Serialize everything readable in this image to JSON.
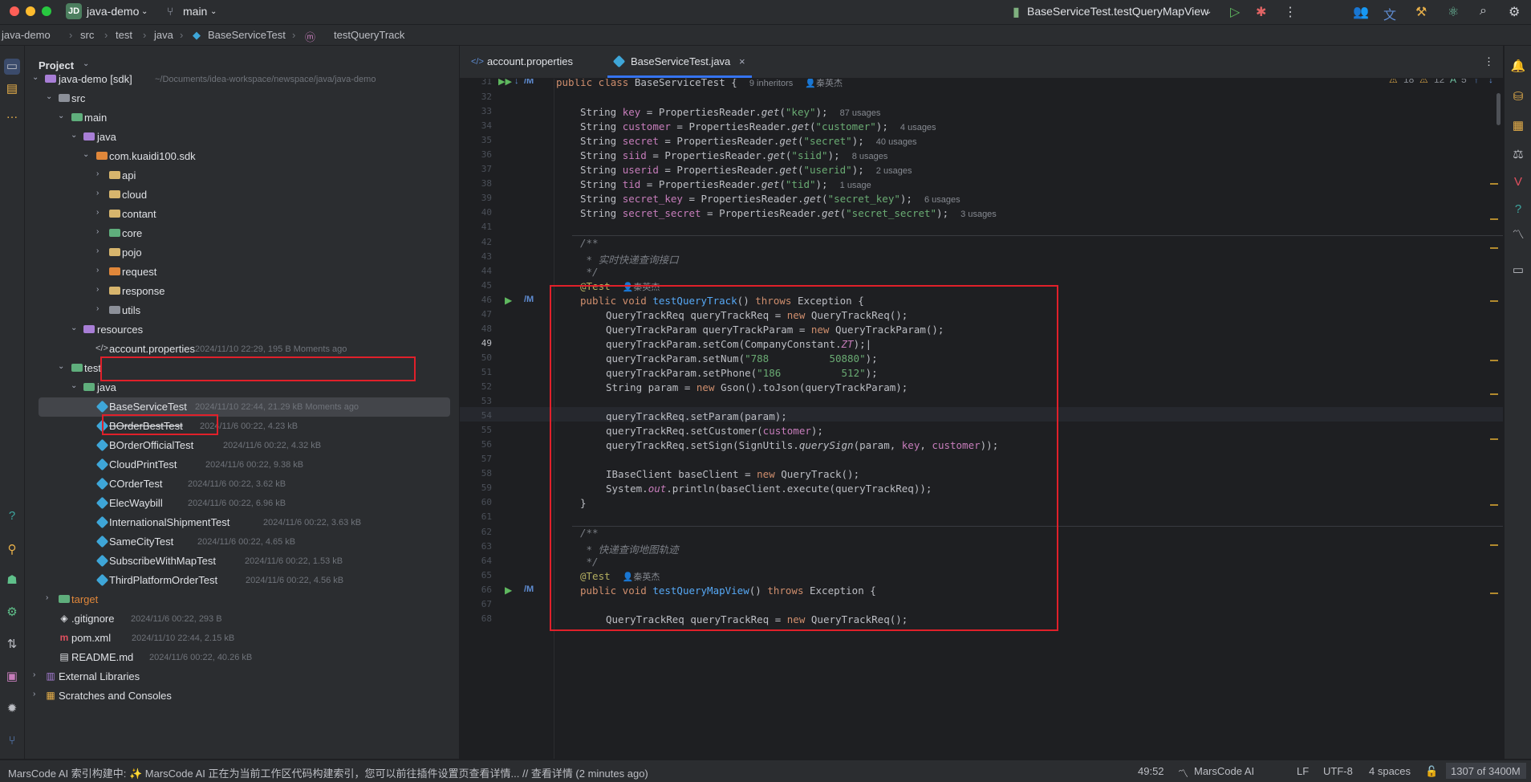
{
  "titlebar": {
    "project_badge": "JD",
    "project_name": "java-demo",
    "branch": "main",
    "run_config": "BaseServiceTest.testQueryMapView"
  },
  "breadcrumb": [
    "java-demo",
    "src",
    "test",
    "java",
    "BaseServiceTest",
    "testQueryTrack"
  ],
  "project_panel": {
    "title": "Project",
    "tree": [
      {
        "label": "java-demo [sdk]",
        "meta": "~/Documents/idea-workspace/newspace/java/java-demo"
      },
      {
        "label": "src",
        "meta": ""
      },
      {
        "label": "main",
        "meta": ""
      },
      {
        "label": "java",
        "meta": ""
      },
      {
        "label": "com.kuaidi100.sdk",
        "meta": ""
      },
      {
        "label": "api",
        "meta": ""
      },
      {
        "label": "cloud",
        "meta": ""
      },
      {
        "label": "contant",
        "meta": ""
      },
      {
        "label": "core",
        "meta": ""
      },
      {
        "label": "pojo",
        "meta": ""
      },
      {
        "label": "request",
        "meta": ""
      },
      {
        "label": "response",
        "meta": ""
      },
      {
        "label": "utils",
        "meta": ""
      },
      {
        "label": "resources",
        "meta": ""
      },
      {
        "label": "account.properties",
        "meta": "2024/11/10 22:29, 195 B Moments ago"
      },
      {
        "label": "test",
        "meta": ""
      },
      {
        "label": "java",
        "meta": ""
      },
      {
        "label": "BaseServiceTest",
        "meta": "2024/11/10 22:44, 21.29 kB Moments ago"
      },
      {
        "label": "BOrderBestTest",
        "meta": "2024/11/6 00:22, 4.23 kB"
      },
      {
        "label": "BOrderOfficialTest",
        "meta": "2024/11/6 00:22, 4.32 kB"
      },
      {
        "label": "CloudPrintTest",
        "meta": "2024/11/6 00:22, 9.38 kB"
      },
      {
        "label": "COrderTest",
        "meta": "2024/11/6 00:22, 3.62 kB"
      },
      {
        "label": "ElecWaybill",
        "meta": "2024/11/6 00:22, 6.96 kB"
      },
      {
        "label": "InternationalShipmentTest",
        "meta": "2024/11/6 00:22, 3.63 kB"
      },
      {
        "label": "SameCityTest",
        "meta": "2024/11/6 00:22, 4.65 kB"
      },
      {
        "label": "SubscribeWithMapTest",
        "meta": "2024/11/6 00:22, 1.53 kB"
      },
      {
        "label": "ThirdPlatformOrderTest",
        "meta": "2024/11/6 00:22, 4.56 kB"
      },
      {
        "label": "target",
        "meta": ""
      },
      {
        "label": ".gitignore",
        "meta": "2024/11/6 00:22, 293 B"
      },
      {
        "label": "pom.xml",
        "meta": "2024/11/10 22:44, 2.15 kB"
      },
      {
        "label": "README.md",
        "meta": "2024/11/6 00:22, 40.26 kB"
      },
      {
        "label": "External Libraries",
        "meta": ""
      },
      {
        "label": "Scratches and Consoles",
        "meta": ""
      }
    ]
  },
  "tabs": [
    {
      "label": "account.properties"
    },
    {
      "label": "BaseServiceTest.java"
    }
  ],
  "editor": {
    "inspections": {
      "warnings": "18",
      "weak_warnings": "12",
      "typos": "5"
    },
    "line_numbers": [
      "31",
      "32",
      "33",
      "34",
      "35",
      "36",
      "37",
      "38",
      "39",
      "40",
      "41",
      "42",
      "43",
      "44",
      "45",
      "46",
      "47",
      "48",
      "49",
      "50",
      "51",
      "52",
      "53",
      "54",
      "55",
      "56",
      "57",
      "58",
      "59",
      "60",
      "61",
      "62",
      "63",
      "64",
      "65",
      "66",
      "67",
      "68"
    ],
    "class_hint": "9 inheritors",
    "author": "秦英杰",
    "usages": [
      "87 usages",
      "4 usages",
      "40 usages",
      "8 usages",
      "2 usages",
      "1 usage",
      "6 usages",
      "3 usages"
    ],
    "comment_1": "实时快递查询接口",
    "comment_2": "快递查询地图轨迹",
    "num_value": "788          50880",
    "phone_value": "186          512"
  },
  "status": {
    "message": "MarsCode AI 索引构建中: ✨ MarsCode AI 正在为当前工作区代码构建索引，您可以前往插件设置页查看详情... // 查看详情 (2 minutes ago)",
    "position": "49:52",
    "plugin": "MarsCode AI",
    "line_sep": "LF",
    "encoding": "UTF-8",
    "indent": "4 spaces",
    "memory": "1307 of 3400M"
  }
}
